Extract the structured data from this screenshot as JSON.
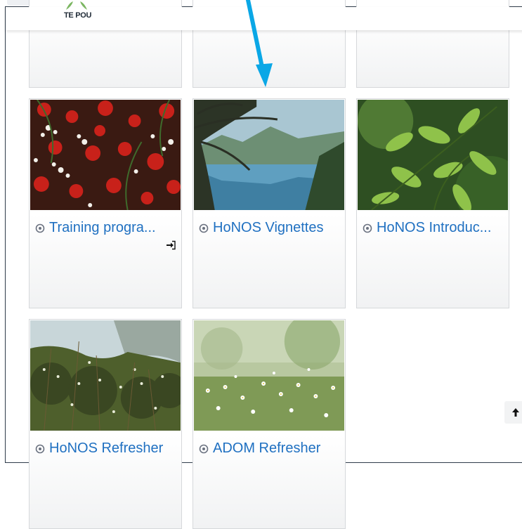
{
  "header": {
    "logo_text": "TE POU"
  },
  "courses": [
    {
      "title": "Training progra...",
      "full_title": "Training progra...",
      "image": "red-and-white-flowers-image",
      "has_enrol_icon": true
    },
    {
      "title": "HoNOS Vignettes",
      "image": "lake-mountain-tree-image",
      "has_enrol_icon": false
    },
    {
      "title": "HoNOS Introduc...",
      "image": "green-leaves-image",
      "has_enrol_icon": false
    },
    {
      "title": "HoNOS Refresher",
      "image": "flowering-shrubs-image",
      "has_enrol_icon": false
    },
    {
      "title": "ADOM Refresher",
      "image": "daisy-meadow-image",
      "has_enrol_icon": false
    }
  ],
  "colors": {
    "link": "#1f70c1",
    "annotation_arrow": "#0aa7e6",
    "window_border": "#2f3b4a"
  },
  "icons": {
    "course": "course-icon",
    "enrol": "enrol-icon",
    "back_to_top": "arrow-up-icon"
  }
}
